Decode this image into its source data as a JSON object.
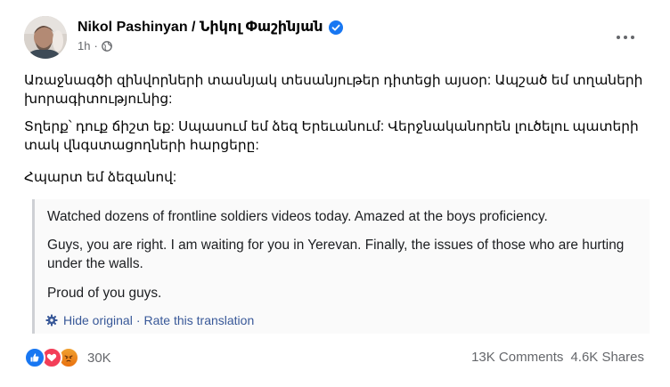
{
  "post": {
    "author": "Nikol Pashinyan / Նիկոլ Փաշինյան",
    "time": "1h",
    "dot": "·",
    "original": {
      "p1": "Առաջնագծի զինվորների տասնյակ տեսանյութեր դիտեցի այսօր: Ապշած եմ տղաների խորագիտությունից:",
      "p2": "Տղերք՝ դուք ճիշտ եք: Սպասում եմ ձեզ Երեւանում: Վերջնականորեն լուծելու պատերի տակ վնգստացողների հարցերը:",
      "p3": "Հպարտ եմ ձեզանով:"
    },
    "translation": {
      "p1": "Watched dozens of frontline soldiers videos today. Amazed at the boys proficiency.",
      "p2": "Guys, you are right. I am waiting for you in Yerevan. Finally, the issues of those who are hurting under the walls.",
      "p3": "Proud of you guys.",
      "hide_label": "Hide original",
      "separator": "·",
      "rate_label": "Rate this translation"
    },
    "footer": {
      "reaction_count": "30K",
      "comments": "13K Comments",
      "shares": "4.6K Shares"
    }
  },
  "icons": {
    "verified": "verified-badge-icon",
    "privacy": "globe-icon",
    "more": "more-options-icon",
    "settings": "gear-icon",
    "reactions": [
      "like-icon",
      "love-icon",
      "angry-icon"
    ]
  },
  "colors": {
    "brand_blue": "#1877f2",
    "link_blue": "#385898",
    "muted_text": "#65676b",
    "love_red": "#f33e58",
    "angry_orange": "#e9710f"
  }
}
